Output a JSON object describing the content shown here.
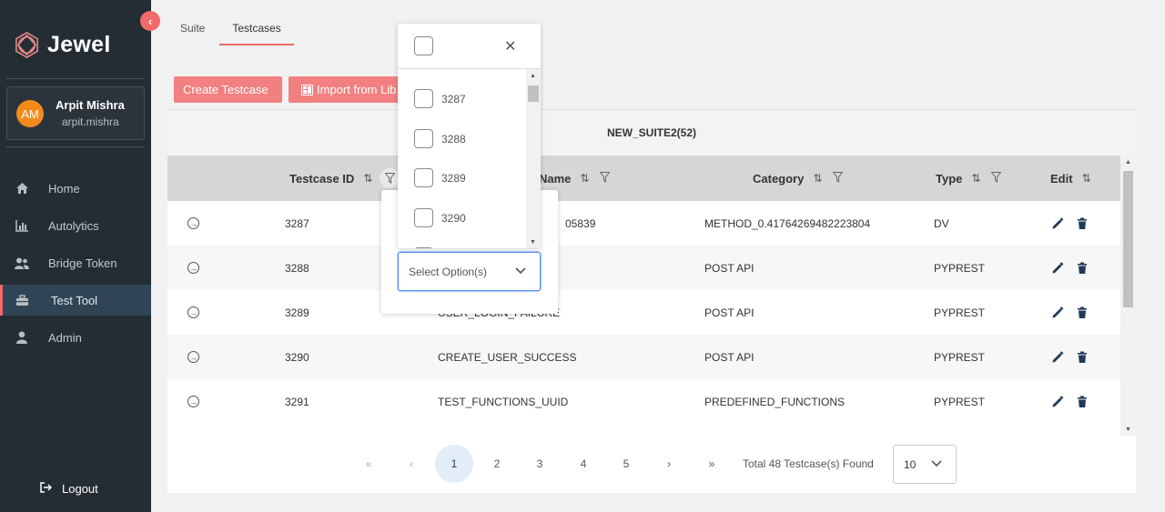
{
  "app": {
    "name": "Jewel"
  },
  "user": {
    "initials": "AM",
    "name": "Arpit Mishra",
    "handle": "arpit.mishra"
  },
  "sidebar": {
    "items": [
      {
        "label": "Home",
        "icon": "home-icon",
        "active": false
      },
      {
        "label": "Autolytics",
        "icon": "bar-chart-icon",
        "active": false
      },
      {
        "label": "Bridge Token",
        "icon": "users-icon",
        "active": false
      },
      {
        "label": "Test Tool",
        "icon": "toolbox-icon",
        "active": true
      },
      {
        "label": "Admin",
        "icon": "user-icon",
        "active": false
      }
    ],
    "logout_label": "Logout"
  },
  "tabs": [
    {
      "label": "Suite",
      "active": false
    },
    {
      "label": "Testcases",
      "active": true
    }
  ],
  "toolbar": {
    "create_label": "Create Testcase",
    "import_label": "Import from Lib"
  },
  "suite_title": "NEW_SUITE2(52)",
  "table": {
    "headers": {
      "testcase_id": "Testcase ID",
      "name": "Name",
      "category": "Category",
      "type": "Type",
      "edit": "Edit"
    },
    "rows": [
      {
        "id": "3287",
        "name": "05839",
        "category": "METHOD_0.41764269482223804",
        "type": "DV"
      },
      {
        "id": "3288",
        "name": "",
        "category": "POST API",
        "type": "PYPREST"
      },
      {
        "id": "3289",
        "name": "USER_LOGIN_FAILURE",
        "category": "POST API",
        "type": "PYPREST"
      },
      {
        "id": "3290",
        "name": "CREATE_USER_SUCCESS",
        "category": "POST API",
        "type": "PYPREST"
      },
      {
        "id": "3291",
        "name": "TEST_FUNCTIONS_UUID",
        "category": "PREDEFINED_FUNCTIONS",
        "type": "PYPREST"
      }
    ]
  },
  "pagination": {
    "pages": [
      "1",
      "2",
      "3",
      "4",
      "5"
    ],
    "current": "1",
    "first": "«",
    "prev": "‹",
    "next": "›",
    "last": "»",
    "total_text": "Total 48 Testcase(s) Found",
    "per_page": "10"
  },
  "filter": {
    "placeholder": "Select Option(s)",
    "options": [
      "3287",
      "3288",
      "3289",
      "3290"
    ]
  },
  "colors": {
    "accent": "#f06a6a",
    "sidebar_bg": "#252d34",
    "active_nav_bg": "#2f4556",
    "icon_dark": "#1f3b57"
  }
}
